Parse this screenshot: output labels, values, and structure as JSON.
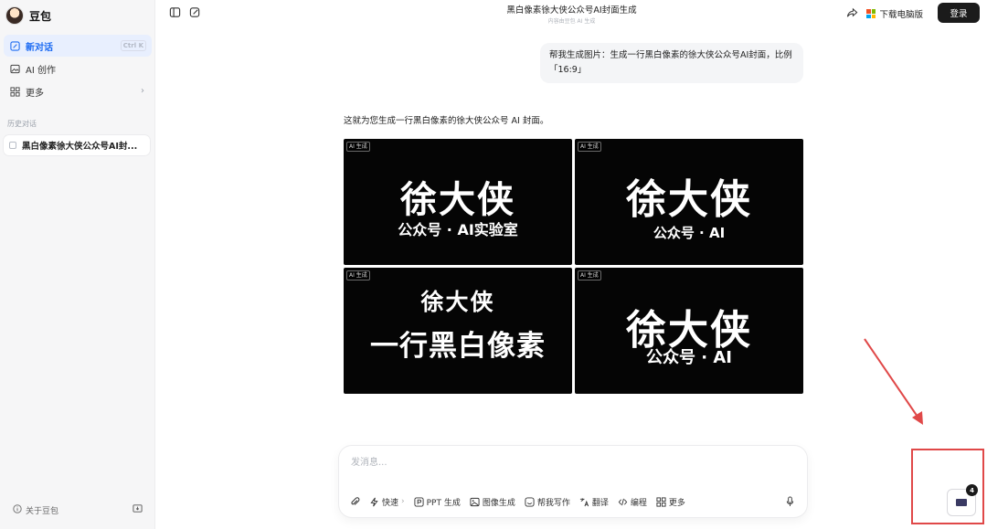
{
  "sidebar": {
    "brand": "豆包",
    "items": [
      {
        "label": "新对话",
        "shortcut": "Ctrl K",
        "active": true,
        "icon": "edit-icon"
      },
      {
        "label": "AI 创作",
        "icon": "image-icon"
      },
      {
        "label": "更多",
        "icon": "grid-icon"
      }
    ],
    "history_label": "历史对话",
    "history_items": [
      "黑白像素徐大侠公众号AI封..."
    ],
    "footer_about": "关于豆包"
  },
  "header": {
    "title": "黑白像素徐大侠公众号AI封面生成",
    "subtitle": "内容由豆包 AI 生成",
    "download_label": "下载电脑版",
    "login_label": "登录"
  },
  "chat": {
    "user_message": "帮我生成图片：生成一行黑白像素的徐大侠公众号AI封面，比例 「16:9」",
    "reply": "这就为您生成一行黑白像素的徐大侠公众号 AI 封面。",
    "images": [
      {
        "badge": "AI 生成",
        "title": "徐大侠",
        "subtitle": "公众号 · AI实验室"
      },
      {
        "badge": "AI 生成",
        "title": "徐大侠",
        "subtitle": "公众号 · AI"
      },
      {
        "badge": "AI 生成",
        "title": "徐大侠",
        "subtitle": "一行黑白像素"
      },
      {
        "badge": "AI 生成",
        "title": "徐大侠",
        "subtitle": "公众号 · AI"
      }
    ]
  },
  "composer": {
    "placeholder": "发消息...",
    "tools": [
      {
        "label": "快速",
        "icon": "lightning-icon"
      },
      {
        "label": "PPT 生成",
        "icon": "ppt-icon"
      },
      {
        "label": "图像生成",
        "icon": "image-gen-icon"
      },
      {
        "label": "帮我写作",
        "icon": "write-icon"
      },
      {
        "label": "翻译",
        "icon": "translate-icon"
      },
      {
        "label": "编程",
        "icon": "code-icon"
      },
      {
        "label": "更多",
        "icon": "grid-icon"
      }
    ]
  },
  "floating": {
    "badge_count": "4"
  },
  "colors": {
    "accent": "#1e6cf2",
    "annotation": "#e04848",
    "dark": "#1b1b1b"
  }
}
